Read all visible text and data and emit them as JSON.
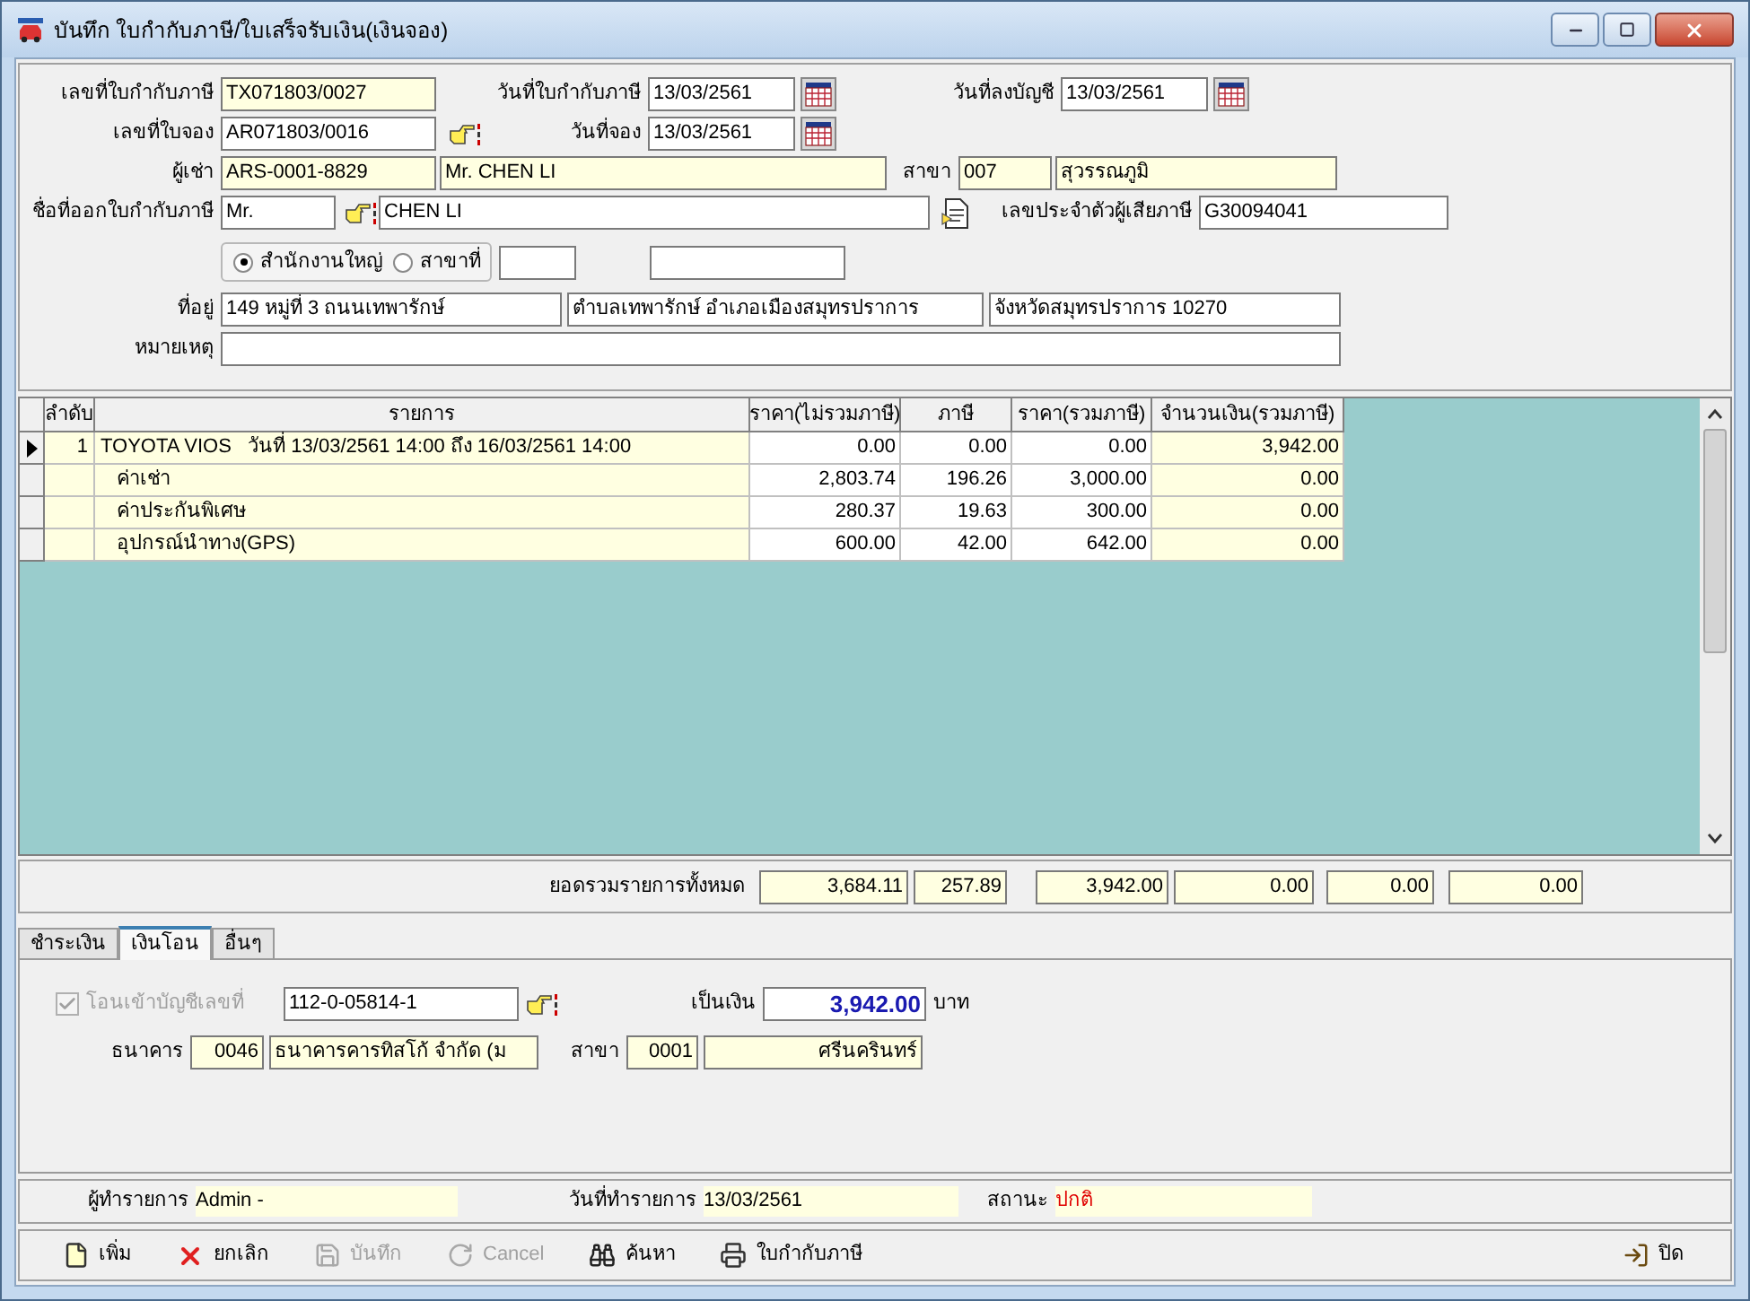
{
  "window": {
    "title": "บันทึก ใบกำกับภาษี/ใบเสร็จรับเงิน(เงินจอง)"
  },
  "form": {
    "tax_invoice_no": {
      "label": "เลขที่ใบกำกับภาษี",
      "value": "TX071803/0027"
    },
    "tax_invoice_date": {
      "label": "วันที่ใบกำกับภาษี",
      "value": "13/03/2561"
    },
    "posting_date": {
      "label": "วันที่ลงบัญชี",
      "value": "13/03/2561"
    },
    "booking_no": {
      "label": "เลขที่ใบจอง",
      "value": "AR071803/0016"
    },
    "booking_date": {
      "label": "วันที่จอง",
      "value": "13/03/2561"
    },
    "renter": {
      "label": "ผู้เช่า",
      "code": "ARS-0001-8829",
      "name": "Mr. CHEN LI"
    },
    "branch": {
      "label": "สาขา",
      "code": "007",
      "name": "สุวรรณภูมิ"
    },
    "invoice_name": {
      "label": "ชื่อที่ออกใบกำกับภาษี",
      "title": "Mr.",
      "name": "CHEN LI"
    },
    "tax_id": {
      "label": "เลขประจำตัวผู้เสียภาษี",
      "value": "G30094041"
    },
    "office": [
      {
        "label": "สำนักงานใหญ่",
        "selected": true
      },
      {
        "label": "สาขาที่",
        "selected": false
      }
    ],
    "address": {
      "label": "ที่อยู่",
      "lines": [
        "149 หมู่ที่ 3 ถนนเทพารักษ์",
        "ตำบลเทพารักษ์ อำเภอเมืองสมุทรปราการ",
        "จังหวัดสมุทรปราการ 10270"
      ]
    },
    "note": {
      "label": "หมายเหตุ"
    }
  },
  "table": {
    "columns": [
      "ลำดับ",
      "รายการ",
      "ราคา(ไม่รวมภาษี)",
      "ภาษี",
      "ราคา(รวมภาษี)",
      "จำนวนเงิน(รวมภาษี)"
    ],
    "rows": [
      {
        "kind": "main",
        "current": true,
        "seq": "1",
        "item": "TOYOTA VIOS   วันที่ 13/03/2561 14:00 ถึง 16/03/2561 14:00",
        "values": [
          "0.00",
          "0.00",
          "0.00",
          "3,942.00"
        ]
      },
      {
        "kind": "sub",
        "current": false,
        "item": "ค่าเช่า",
        "values": [
          "2,803.74",
          "196.26",
          "3,000.00",
          "0.00"
        ]
      },
      {
        "kind": "sub",
        "current": false,
        "item": "ค่าประกันพิเศษ",
        "values": [
          "280.37",
          "19.63",
          "300.00",
          "0.00"
        ]
      },
      {
        "kind": "sub",
        "current": false,
        "item": "อุปกรณ์นำทาง(GPS)",
        "values": [
          "600.00",
          "42.00",
          "642.00",
          "0.00"
        ]
      }
    ]
  },
  "totals": {
    "label": "ยอดรวมรายการทั้งหมด",
    "values": [
      "3,684.11",
      "257.89",
      "3,942.00",
      "0.00",
      "0.00",
      "0.00"
    ]
  },
  "tabs": [
    {
      "label": "ชำระเงิน",
      "selected": false
    },
    {
      "label": "เงินโอน",
      "selected": true
    },
    {
      "label": "อื่นๆ",
      "selected": false
    }
  ],
  "transfer": {
    "account_check": {
      "label": "โอนเข้าบัญชีเลขที่",
      "checked": true,
      "disabled": true
    },
    "account": "112-0-05814-1",
    "amount_label": "เป็นเงิน",
    "amount": "3,942.00",
    "currency": "บาท",
    "bank": {
      "label": "ธนาคาร",
      "code": "0046",
      "name": "ธนาคารคารทิสโก้ จำกัด (ม"
    },
    "branch": {
      "label": "สาขา",
      "code": "0001",
      "name": "ศรีนครินทร์"
    }
  },
  "status": {
    "user": {
      "label": "ผู้ทำรายการ",
      "value": "Admin -"
    },
    "date": {
      "label": "วันที่ทำรายการ",
      "value": "13/03/2561"
    },
    "state": {
      "label": "สถานะ",
      "value": "ปกติ"
    }
  },
  "toolbar": [
    {
      "kind": "new",
      "label": "เพิ่ม",
      "disabled": false
    },
    {
      "kind": "cancel",
      "label": "ยกเลิก",
      "disabled": false
    },
    {
      "kind": "save",
      "label": "บันทึก",
      "disabled": true
    },
    {
      "kind": "undo",
      "label": "Cancel",
      "disabled": true
    },
    {
      "kind": "search",
      "label": "ค้นหา",
      "disabled": false
    },
    {
      "kind": "print",
      "label": "ใบกำกับภาษี",
      "disabled": false
    }
  ],
  "close": {
    "label": "ปิด"
  }
}
